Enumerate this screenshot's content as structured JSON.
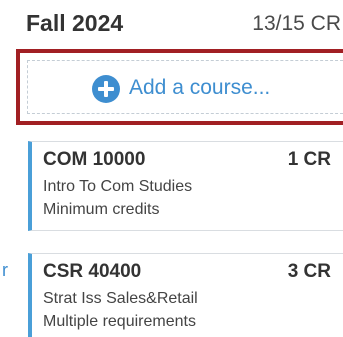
{
  "term": {
    "title": "Fall 2024",
    "credits": "13/15 CR"
  },
  "add_course": {
    "label": "Add a course...",
    "icon": "plus-circle-icon",
    "accent_color": "#3e8ed0",
    "focus_border_color": "#a11f23"
  },
  "courses": [
    {
      "code": "COM 10000",
      "credits": "1 CR",
      "name": "Intro To Com Studies",
      "requirement": "Minimum credits"
    },
    {
      "code": "CSR 40400",
      "credits": "3 CR",
      "name": "Strat Iss Sales&Retail",
      "requirement": "Multiple requirements"
    }
  ],
  "edge_fragment": "r",
  "colors": {
    "card_accent": "#4a9fd8",
    "text_primary": "#333333"
  }
}
